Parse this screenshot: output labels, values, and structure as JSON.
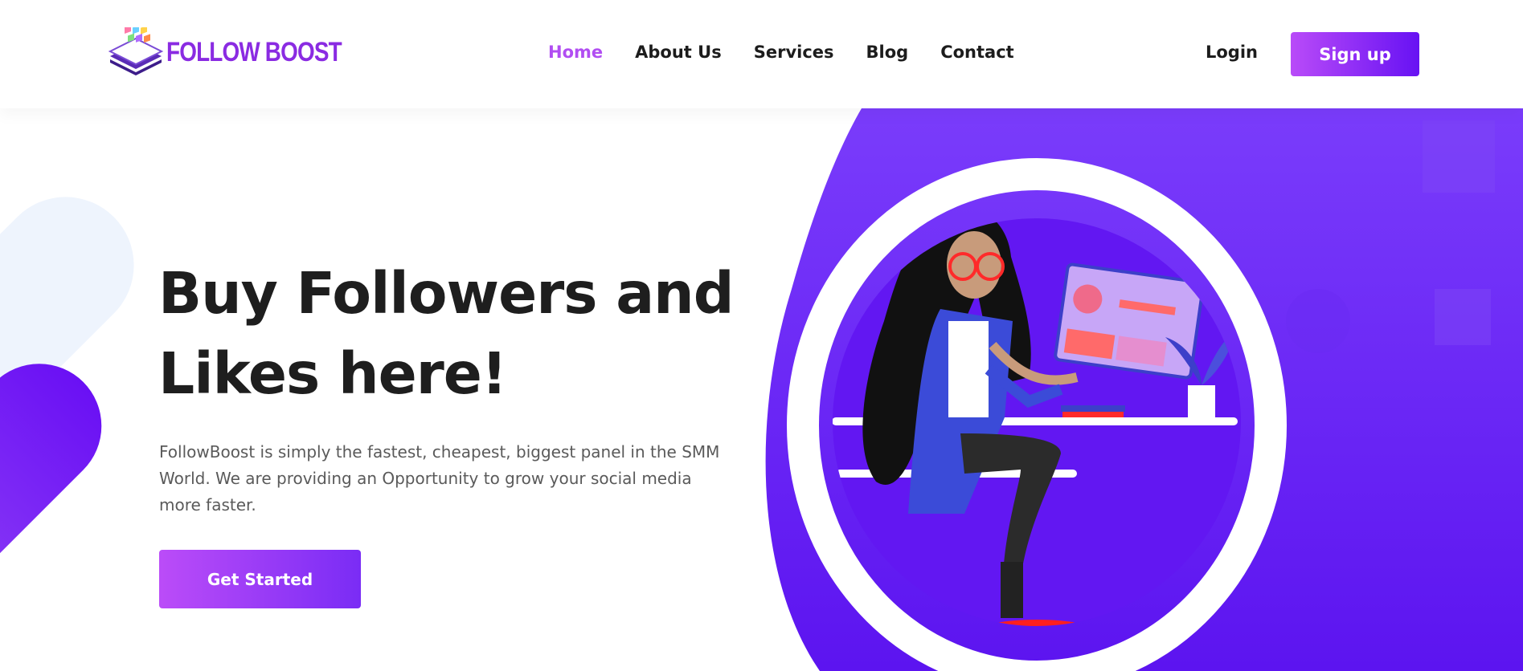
{
  "brand": {
    "name": "FOLLOW BOOST"
  },
  "nav": {
    "items": [
      {
        "label": "Home",
        "active": true
      },
      {
        "label": "About Us",
        "active": false
      },
      {
        "label": "Services",
        "active": false
      },
      {
        "label": "Blog",
        "active": false
      },
      {
        "label": "Contact",
        "active": false
      }
    ],
    "login_label": "Login",
    "signup_label": "Sign up"
  },
  "hero": {
    "title_line1": "Buy Followers and",
    "title_line2": "Likes here!",
    "description": "FollowBoost is simply the fastest, cheapest, biggest panel in the SMM World. We are providing an Opportunity to grow your social media more faster.",
    "cta_label": "Get Started"
  },
  "colors": {
    "accent": "#b14ef2",
    "primary_purple": "#6712f3",
    "hero_bg": "#6d1ff5",
    "text_dark": "#1e1e1e"
  },
  "icons": {
    "logo": "smartphone-app-grid-icon",
    "illustration": "woman-at-desk-illustration"
  }
}
